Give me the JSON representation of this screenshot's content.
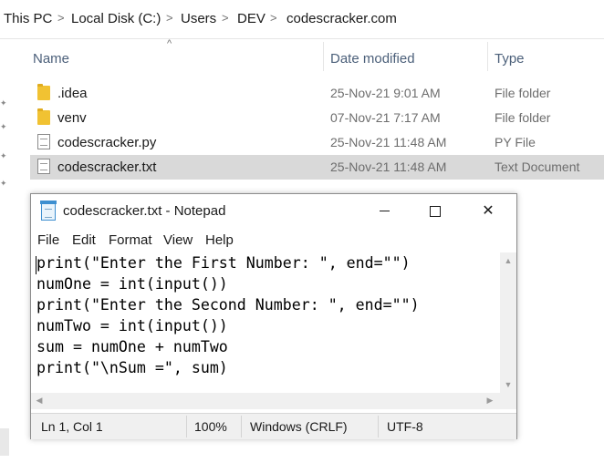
{
  "explorer": {
    "breadcrumb": [
      "This PC",
      "Local Disk (C:)",
      "Users",
      "DEV",
      "codescracker.com"
    ],
    "breadcrumb_separator": ">",
    "columns": {
      "name": "Name",
      "date_modified": "Date modified",
      "type": "Type"
    },
    "sort_indicator": "^",
    "files": [
      {
        "name": ".idea",
        "date": "25-Nov-21 9:01 AM",
        "type": "File folder",
        "icon": "folder-icon"
      },
      {
        "name": "venv",
        "date": "07-Nov-21 7:17 AM",
        "type": "File folder",
        "icon": "folder-icon"
      },
      {
        "name": "codescracker.py",
        "date": "25-Nov-21 11:48 AM",
        "type": "PY File",
        "icon": "python-file-icon"
      },
      {
        "name": "codescracker.txt",
        "date": "25-Nov-21 11:48 AM",
        "type": "Text Document",
        "icon": "text-file-icon",
        "selected": true
      }
    ]
  },
  "notepad": {
    "title": "codescracker.txt - Notepad",
    "menu": [
      "File",
      "Edit",
      "Format",
      "View",
      "Help"
    ],
    "code_lines": [
      "print(\"Enter the First Number: \", end=\"\")",
      "numOne = int(input())",
      "print(\"Enter the Second Number: \", end=\"\")",
      "numTwo = int(input())",
      "sum = numOne + numTwo",
      "print(\"\\nSum =\", sum)"
    ],
    "status": {
      "position": "Ln 1, Col 1",
      "zoom": "100%",
      "line_ending": "Windows (CRLF)",
      "encoding": "UTF-8"
    }
  },
  "colors": {
    "selection": "#d9d9d9",
    "column_header": "#4c607a",
    "folder": "#f1c232"
  }
}
